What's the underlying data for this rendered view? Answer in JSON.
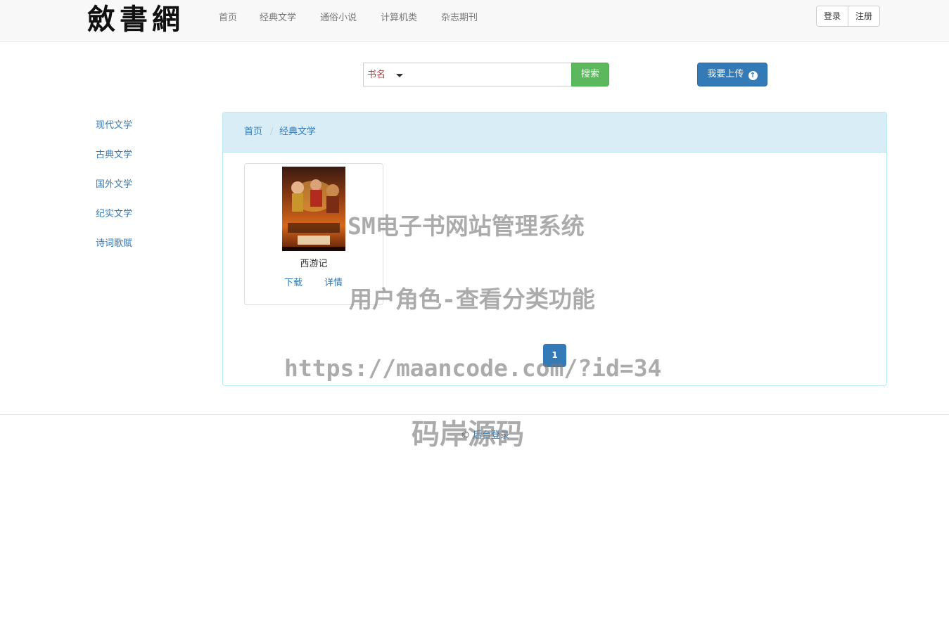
{
  "header": {
    "logo": "斂書網",
    "nav": [
      "首页",
      "经典文学",
      "通俗小说",
      "计算机类",
      "杂志期刊"
    ],
    "login_label": "登录",
    "register_label": "注册"
  },
  "search": {
    "type_label": "书名",
    "value": "",
    "button_label": "搜索"
  },
  "upload": {
    "label": "我要上传"
  },
  "sidebar": {
    "items": [
      "现代文学",
      "古典文学",
      "国外文学",
      "纪实文学",
      "诗词歌赋"
    ]
  },
  "breadcrumb": {
    "items": [
      "首页",
      "经典文学"
    ]
  },
  "books": [
    {
      "title": "西游记",
      "download_label": "下载",
      "detail_label": "详情"
    }
  ],
  "pagination": {
    "current": "1"
  },
  "footer": {
    "copyright": "©",
    "admin_link": "后台登录"
  },
  "watermarks": {
    "line1": "SM电子书网站管理系统",
    "line2": "用户角色-查看分类功能",
    "line3": "https://maancode.com/?id=34",
    "line4": "码岸源码"
  },
  "colors": {
    "primary": "#337ab7",
    "success": "#5cb85c",
    "info_bg": "#d9edf7",
    "danger_text": "#a94442"
  }
}
